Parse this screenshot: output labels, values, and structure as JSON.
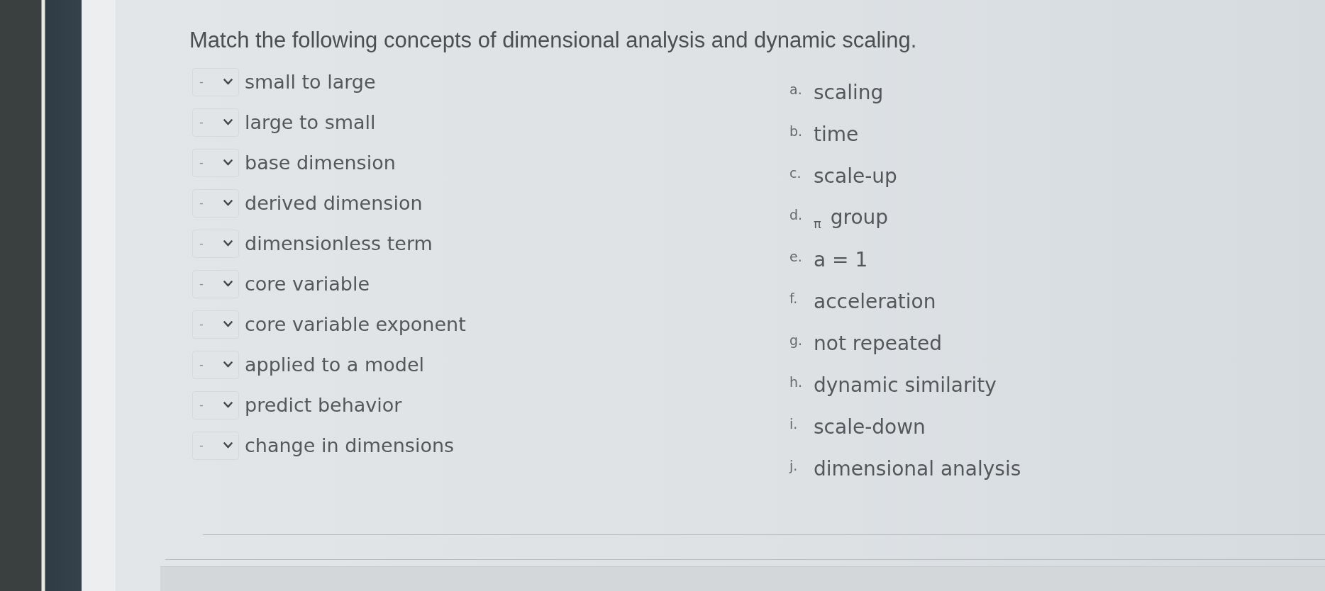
{
  "question": {
    "prompt": "Match the following concepts of dimensional analysis and dynamic scaling."
  },
  "matches": [
    {
      "answer": "-",
      "term": "small to large"
    },
    {
      "answer": "-",
      "term": "large to small"
    },
    {
      "answer": "-",
      "term": "base dimension"
    },
    {
      "answer": "-",
      "term": "derived dimension"
    },
    {
      "answer": "-",
      "term": "dimensionless term"
    },
    {
      "answer": "-",
      "term": "core variable"
    },
    {
      "answer": "-",
      "term": "core variable exponent"
    },
    {
      "answer": "-",
      "term": "applied to a model"
    },
    {
      "answer": "-",
      "term": "predict behavior"
    },
    {
      "answer": "-",
      "term": "change in dimensions"
    }
  ],
  "options": [
    {
      "letter": "a.",
      "text": "scaling"
    },
    {
      "letter": "b.",
      "text": "time"
    },
    {
      "letter": "c.",
      "text": "scale-up"
    },
    {
      "letter": "d.",
      "text": "$_{π}$ group"
    },
    {
      "letter": "e.",
      "text": "a = 1"
    },
    {
      "letter": "f.",
      "text": "acceleration"
    },
    {
      "letter": "g.",
      "text": "not repeated"
    },
    {
      "letter": "h.",
      "text": "dynamic similarity"
    },
    {
      "letter": "i.",
      "text": "scale-down"
    },
    {
      "letter": "j.",
      "text": "dimensional analysis"
    }
  ]
}
